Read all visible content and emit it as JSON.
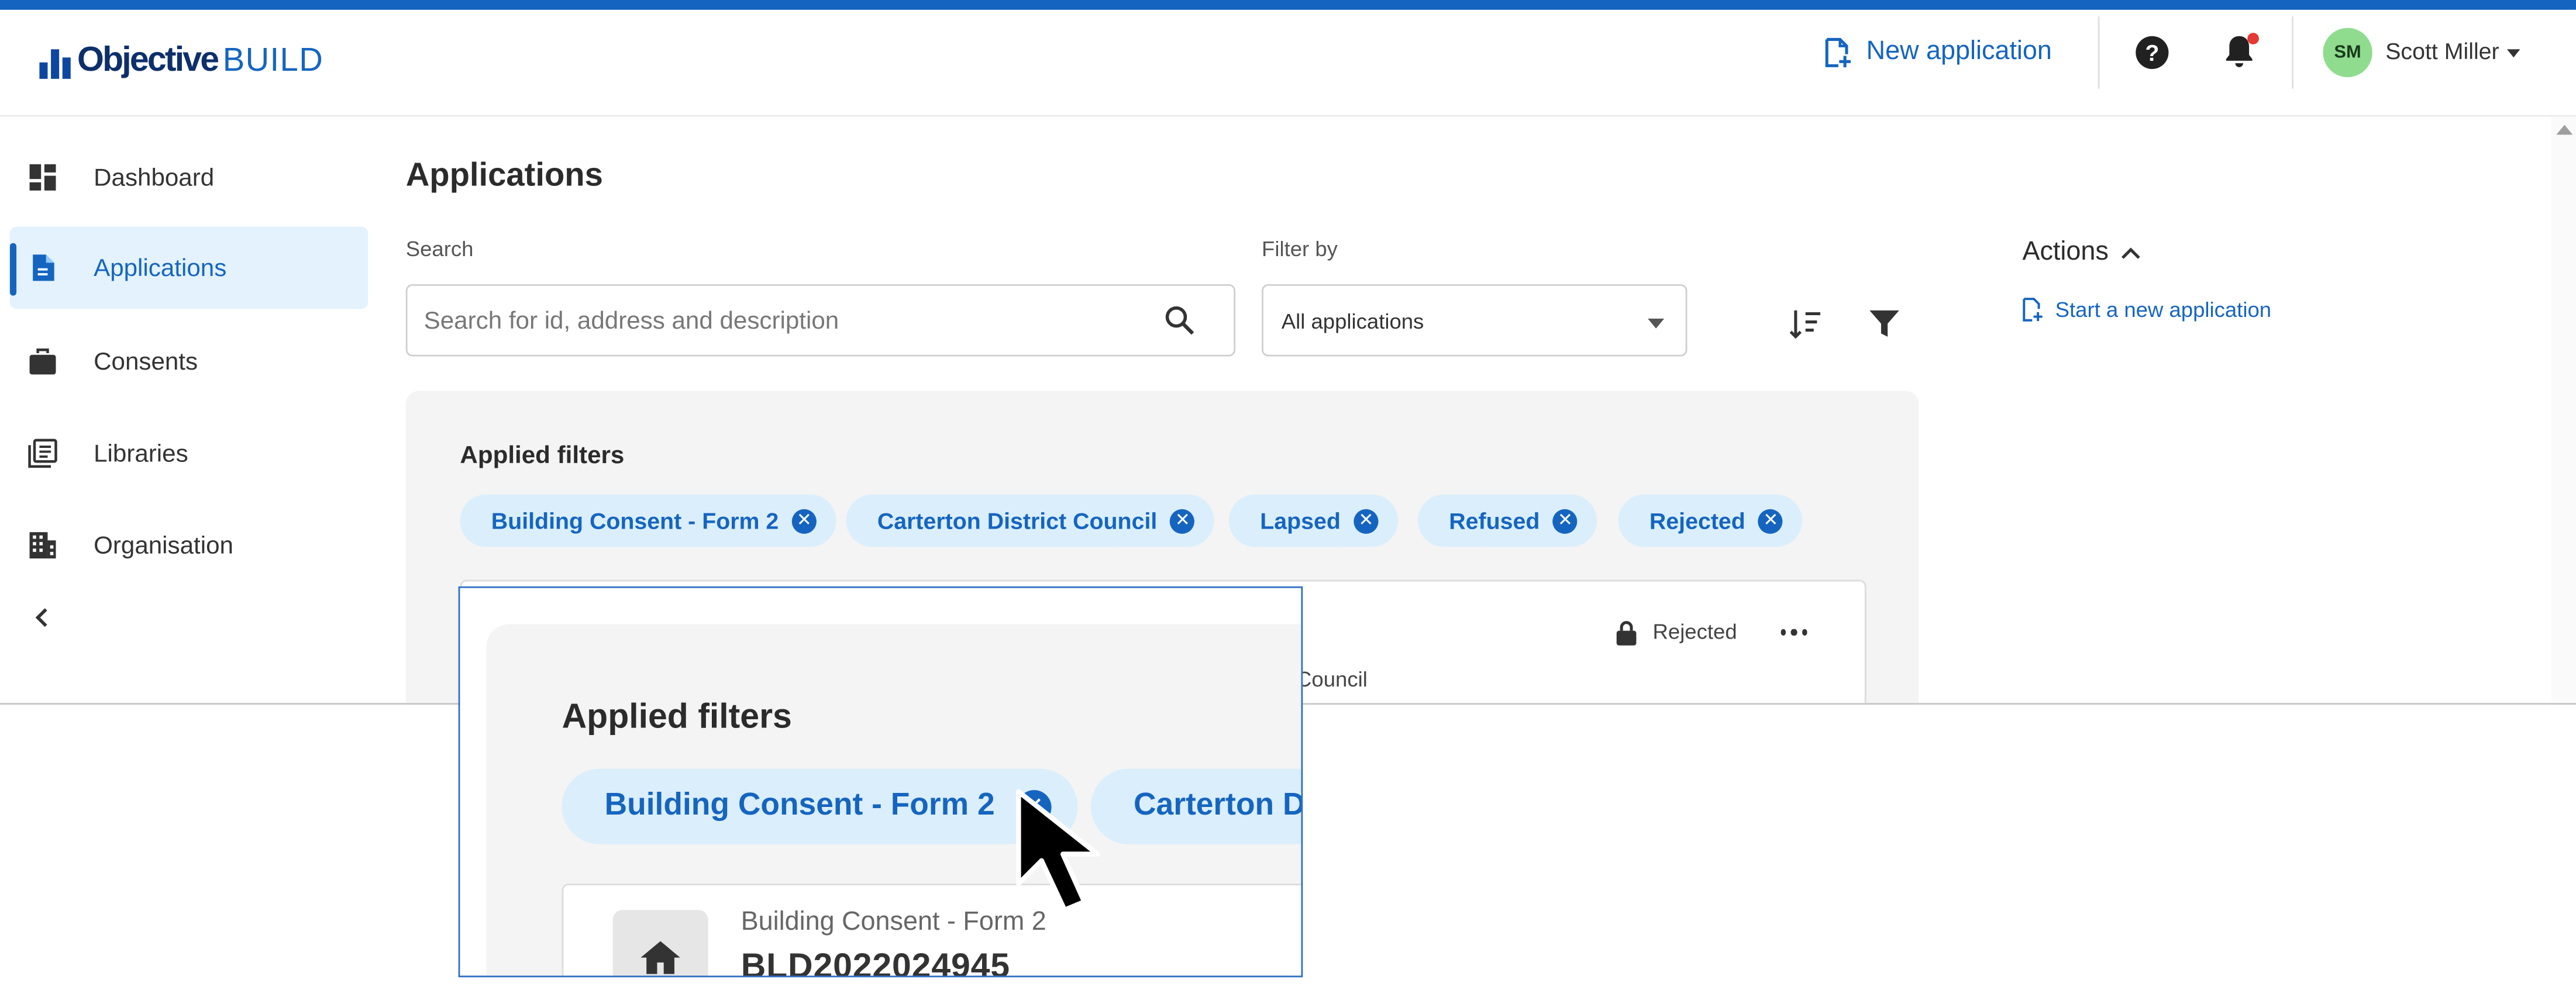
{
  "header": {
    "logo_bold": "Objective",
    "logo_light": "BUILD",
    "new_application": "New application",
    "help_icon": "?",
    "user": {
      "initials": "SM",
      "name": "Scott Miller"
    }
  },
  "sidebar": {
    "items": [
      {
        "label": "Dashboard",
        "icon": "dashboard-icon"
      },
      {
        "label": "Applications",
        "icon": "document-icon",
        "active": true
      },
      {
        "label": "Consents",
        "icon": "briefcase-icon"
      },
      {
        "label": "Libraries",
        "icon": "library-icon"
      },
      {
        "label": "Organisation",
        "icon": "building-icon"
      }
    ],
    "collapse_icon": "chevron-left-icon"
  },
  "main": {
    "title": "Applications",
    "search": {
      "label": "Search",
      "placeholder": "Search for id, address and description"
    },
    "filter": {
      "label": "Filter by",
      "value": "All applications"
    },
    "applied_filters": {
      "title": "Applied filters",
      "chips": [
        "Building Consent - Form 2",
        "Carterton District Council",
        "Lapsed",
        "Refused",
        "Rejected"
      ]
    },
    "card": {
      "status": "Rejected",
      "council_partial": "Council"
    }
  },
  "actions": {
    "title": "Actions",
    "start_link": "Start a new application"
  },
  "zoom": {
    "title": "Applied filters",
    "chip_1": "Building Consent - Form 2",
    "chip_2_partial": "Carterton D",
    "card_type": "Building Consent - Form 2",
    "card_id": "BLD2022024945"
  },
  "colors": {
    "accent": "#1565c0",
    "chip_bg": "#dbeefb",
    "active_nav_bg": "#e3f2fd",
    "avatar_bg": "#8fdc8f",
    "notification_dot": "#e53935"
  }
}
